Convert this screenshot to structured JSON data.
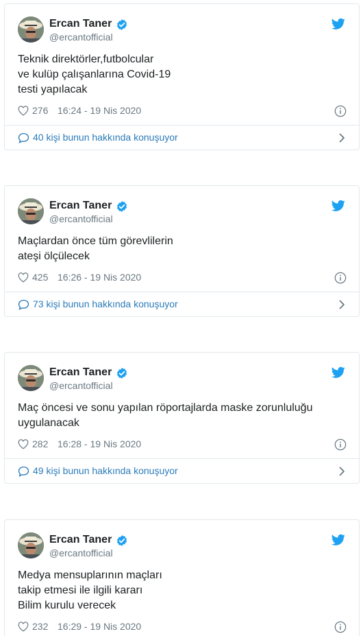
{
  "tweets": [
    {
      "name": "Ercan Taner",
      "handle": "@ercantofficial",
      "text": [
        "Teknik direktörler,futbolcular",
        "ve kulüp çalışanlarına Covid-19",
        "testi yapılacak"
      ],
      "likes": "276",
      "time": "16:24 - 19 Nis 2020",
      "conversation": "40 kişi bunun hakkında konuşuyor"
    },
    {
      "name": "Ercan Taner",
      "handle": "@ercantofficial",
      "text": [
        "Maçlardan önce tüm görevlilerin",
        "ateşi ölçülecek"
      ],
      "likes": "425",
      "time": "16:26 - 19 Nis 2020",
      "conversation": "73 kişi bunun hakkında konuşuyor"
    },
    {
      "name": "Ercan Taner",
      "handle": "@ercantofficial",
      "text": [
        "Maç öncesi ve sonu yapılan röportajlarda maske zorunluluğu",
        "uygulanacak"
      ],
      "likes": "282",
      "time": "16:28 - 19 Nis 2020",
      "conversation": "49 kişi bunun hakkında konuşuyor"
    },
    {
      "name": "Ercan Taner",
      "handle": "@ercantofficial",
      "text": [
        "Medya mensuplarının maçları",
        "takip etmesi ile ilgili kararı",
        "Bilim kurulu verecek"
      ],
      "likes": "232",
      "time": "16:29 - 19 Nis 2020"
    }
  ],
  "icons": {
    "bird": "twitter-bird-icon",
    "verified": "verified-badge-icon",
    "like": "heart-icon",
    "info": "info-icon",
    "conversation": "speech-bubble-icon",
    "chevron": "chevron-right-icon"
  },
  "colors": {
    "accent": "#1da1f2",
    "link": "#2b7bb9",
    "muted": "#697882",
    "border": "#e1e8ed"
  }
}
